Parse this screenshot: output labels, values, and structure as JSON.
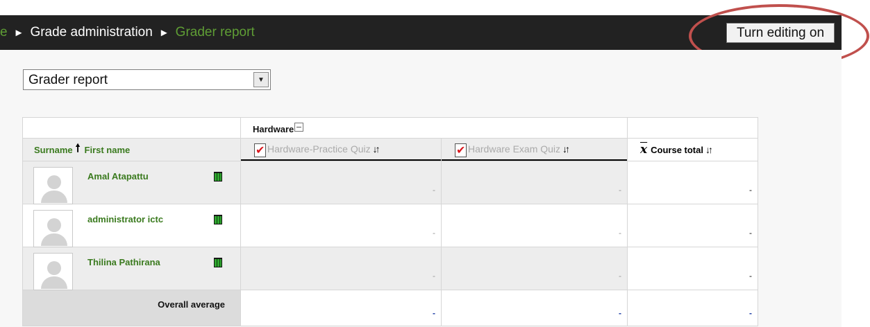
{
  "breadcrumb": {
    "partial_first": "e",
    "item_grade_admin": "Grade administration",
    "item_current": "Grader report",
    "separator": "►"
  },
  "toolbar": {
    "edit_button_label": "Turn editing on"
  },
  "report_selector": {
    "selected": "Grader report"
  },
  "table": {
    "category_name": "Hardware",
    "header": {
      "surname": "Surname",
      "first_name": "First name",
      "quiz1": "Hardware-Practice Quiz",
      "quiz2": "Hardware Exam Quiz",
      "course_total": "Course total"
    },
    "students": [
      {
        "name": "Amal Atapattu",
        "quiz1": "-",
        "quiz2": "-",
        "total": "-"
      },
      {
        "name": "administrator ictc",
        "quiz1": "-",
        "quiz2": "-",
        "total": "-"
      },
      {
        "name": "Thilina Pathirana",
        "quiz1": "-",
        "quiz2": "-",
        "total": "-"
      }
    ],
    "overall_average": {
      "label": "Overall average",
      "quiz1": "-",
      "quiz2": "-",
      "total": "-"
    }
  },
  "colors": {
    "navbar": "#222222",
    "link_green": "#3a7a1e",
    "highlight_ring": "#c0504d",
    "average_blue": "#1f3fa6"
  },
  "icons": [
    "sort-up-icon",
    "quiz-icon",
    "sort-toggle-icon",
    "mean-icon",
    "user-report-icon",
    "collapse-icon",
    "select-arrow-icon",
    "default-avatar-icon"
  ]
}
